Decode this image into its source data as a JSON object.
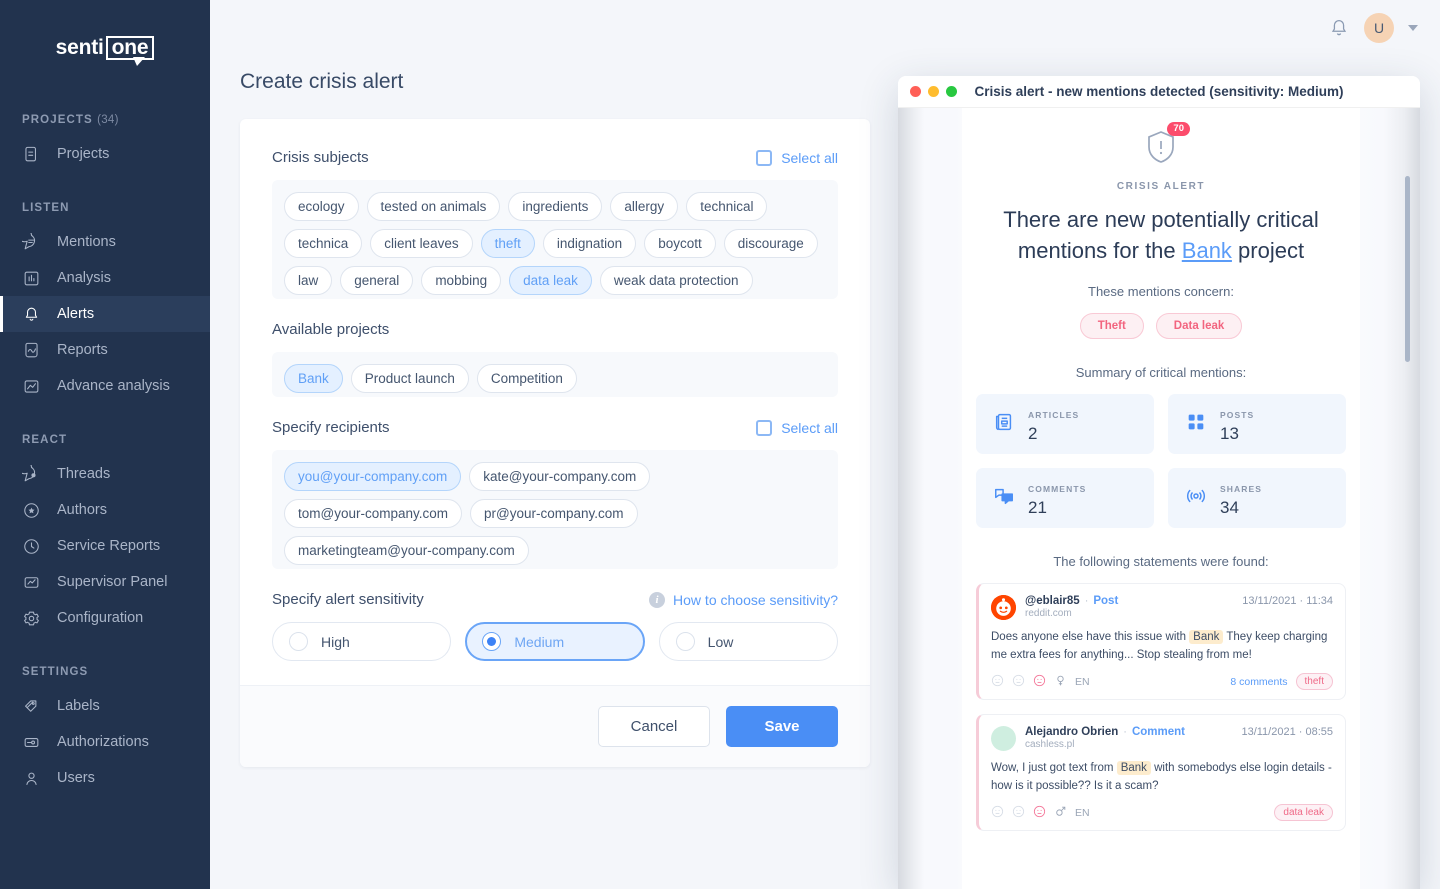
{
  "sidebar": {
    "logo": {
      "part1": "senti",
      "part2": "one"
    },
    "groups": [
      {
        "label": "PROJECTS",
        "count": "(34)",
        "items": [
          {
            "label": "Projects",
            "icon": "documents-icon",
            "active": false
          }
        ]
      },
      {
        "label": "LISTEN",
        "count": "",
        "items": [
          {
            "label": "Mentions",
            "icon": "chat-bubble-icon",
            "active": false
          },
          {
            "label": "Analysis",
            "icon": "bar-chart-icon",
            "active": false
          },
          {
            "label": "Alerts",
            "icon": "bell-icon",
            "active": true
          },
          {
            "label": "Reports",
            "icon": "report-icon",
            "active": false
          },
          {
            "label": "Advance analysis",
            "icon": "line-chart-icon",
            "active": false
          }
        ]
      },
      {
        "label": "REACT",
        "count": "",
        "items": [
          {
            "label": "Threads",
            "icon": "threads-icon",
            "active": false
          },
          {
            "label": "Authors",
            "icon": "star-circle-icon",
            "active": false
          },
          {
            "label": "Service Reports",
            "icon": "clock-icon",
            "active": false
          },
          {
            "label": "Supervisor Panel",
            "icon": "monitor-chart-icon",
            "active": false
          },
          {
            "label": "Configuration",
            "icon": "gear-icon",
            "active": false
          }
        ]
      },
      {
        "label": "SETTINGS",
        "count": "",
        "items": [
          {
            "label": "Labels",
            "icon": "tag-icon",
            "active": false
          },
          {
            "label": "Authorizations",
            "icon": "key-card-icon",
            "active": false
          },
          {
            "label": "Users",
            "icon": "user-icon",
            "active": false
          }
        ]
      }
    ]
  },
  "topbar": {
    "bell_icon": "bell-icon",
    "avatar_initial": "U",
    "avatar_color": "#f6d3b4"
  },
  "main": {
    "page_title": "Create crisis alert",
    "crisis_subjects": {
      "title": "Crisis subjects",
      "select_all": "Select all",
      "chips": [
        {
          "label": "ecology",
          "selected": false
        },
        {
          "label": "tested on animals",
          "selected": false
        },
        {
          "label": "ingredients",
          "selected": false
        },
        {
          "label": "allergy",
          "selected": false
        },
        {
          "label": "technical",
          "selected": false
        },
        {
          "label": "technica",
          "selected": false
        },
        {
          "label": "client leaves",
          "selected": false
        },
        {
          "label": "theft",
          "selected": true
        },
        {
          "label": "indignation",
          "selected": false
        },
        {
          "label": "boycott",
          "selected": false
        },
        {
          "label": "discourage",
          "selected": false
        },
        {
          "label": "law",
          "selected": false
        },
        {
          "label": "general",
          "selected": false
        },
        {
          "label": "mobbing",
          "selected": false
        },
        {
          "label": "data leak",
          "selected": true
        },
        {
          "label": "weak data protection",
          "selected": false
        }
      ]
    },
    "available_projects": {
      "title": "Available projects",
      "chips": [
        {
          "label": "Bank",
          "selected": true
        },
        {
          "label": "Product launch",
          "selected": false
        },
        {
          "label": "Competition",
          "selected": false
        }
      ]
    },
    "recipients": {
      "title": "Specify recipients",
      "select_all": "Select all",
      "chips": [
        {
          "label": "you@your-company.com",
          "selected": true
        },
        {
          "label": "kate@your-company.com",
          "selected": false
        },
        {
          "label": "tom@your-company.com",
          "selected": false
        },
        {
          "label": "pr@your-company.com",
          "selected": false
        },
        {
          "label": "marketingteam@your-company.com",
          "selected": false
        }
      ]
    },
    "sensitivity": {
      "title": "Specify alert sensitivity",
      "help_link": "How to choose sensitivity?",
      "help_icon": "info-icon",
      "options": [
        {
          "label": "High",
          "selected": false
        },
        {
          "label": "Medium",
          "selected": true
        },
        {
          "label": "Low",
          "selected": false
        }
      ]
    },
    "footer": {
      "cancel": "Cancel",
      "save": "Save"
    }
  },
  "modal": {
    "window_title": "Crisis alert - new mentions detected (sensitivity: Medium)",
    "traffic_lights": [
      "close-button",
      "minimize-button",
      "maximize-button"
    ],
    "shield_icon": "shield-alert-icon",
    "badge": "70",
    "eyebrow": "CRISIS ALERT",
    "headline_before": "There are new potentially critical mentions for the ",
    "headline_link": "Bank",
    "headline_after": " project",
    "concern_label": "These mentions concern:",
    "concern_tags": [
      "Theft",
      "Data leak"
    ],
    "summary_label": "Summary of critical mentions:",
    "stats": [
      {
        "key": "ARTICLES",
        "value": "2",
        "icon": "article-icon"
      },
      {
        "key": "POSTS",
        "value": "13",
        "icon": "grid-icon"
      },
      {
        "key": "COMMENTS",
        "value": "21",
        "icon": "comments-icon"
      },
      {
        "key": "SHARES",
        "value": "34",
        "icon": "share-radar-icon"
      }
    ],
    "found_label": "The following statements were found:",
    "mentions": [
      {
        "author": "@eblair85",
        "separator": "·",
        "type": "Post",
        "date": "13/11/2021 · 11:34",
        "source": "reddit.com",
        "avatar": "reddit-avatar",
        "text_before": "Does anyone else have this issue with ",
        "highlight": "Bank",
        "text_after": " They keep charging me extra fees for anything... Stop stealing from me!",
        "gender_icon": "female-icon",
        "lang": "EN",
        "comments": "8 comments",
        "tag": "theft"
      },
      {
        "author": "Alejandro Obrien",
        "separator": "·",
        "type": "Comment",
        "date": "13/11/2021 · 08:55",
        "source": "cashless.pl",
        "avatar": "generic-avatar",
        "text_before": "Wow, I just got text from ",
        "highlight": "Bank",
        "text_after": " with somebodys else login details - how is it possible?? Is it a scam?",
        "gender_icon": "male-icon",
        "lang": "EN",
        "comments": "",
        "tag": "data leak"
      }
    ]
  },
  "colors": {
    "sidebar_bg": "#22334e",
    "accent_blue": "#4a8ef5",
    "link_blue": "#5b9cf8",
    "danger_pink": "#f2647f",
    "badge_red": "#fc4c6c"
  }
}
